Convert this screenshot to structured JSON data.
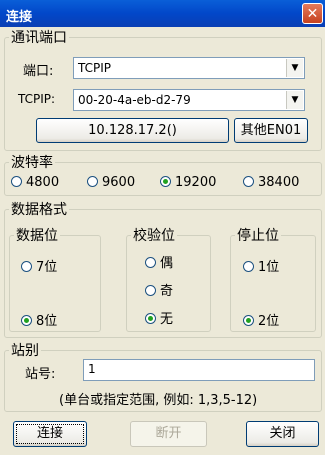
{
  "window": {
    "title": "连接",
    "close_glyph": "✕"
  },
  "comm_port": {
    "legend": "通讯端口",
    "port_label": "端口:",
    "port_value": "TCPIP",
    "tcpip_label": "TCPIP:",
    "tcpip_value": "00-20-4a-eb-d2-79",
    "ip_button": "10.128.17.2()",
    "other_button": "其他EN01"
  },
  "baud": {
    "legend": "波特率",
    "options": [
      {
        "label": "4800",
        "selected": false
      },
      {
        "label": "9600",
        "selected": false
      },
      {
        "label": "19200",
        "selected": true
      },
      {
        "label": "38400",
        "selected": false
      }
    ]
  },
  "data_format": {
    "legend": "数据格式",
    "data_bits": {
      "legend": "数据位",
      "options": [
        {
          "label": "7位",
          "selected": false
        },
        {
          "label": "8位",
          "selected": true
        }
      ]
    },
    "parity": {
      "legend": "校验位",
      "options": [
        {
          "label": "偶",
          "selected": false
        },
        {
          "label": "奇",
          "selected": false
        },
        {
          "label": "无",
          "selected": true
        }
      ]
    },
    "stop_bits": {
      "legend": "停止位",
      "options": [
        {
          "label": "1位",
          "selected": false
        },
        {
          "label": "2位",
          "selected": true
        }
      ]
    }
  },
  "station": {
    "legend": "站别",
    "label": "站号:",
    "value": "1",
    "hint": "(单台或指定范围, 例如: 1,3,5-12)"
  },
  "buttons": {
    "connect": "连接",
    "disconnect": "断开",
    "close": "关闭"
  }
}
